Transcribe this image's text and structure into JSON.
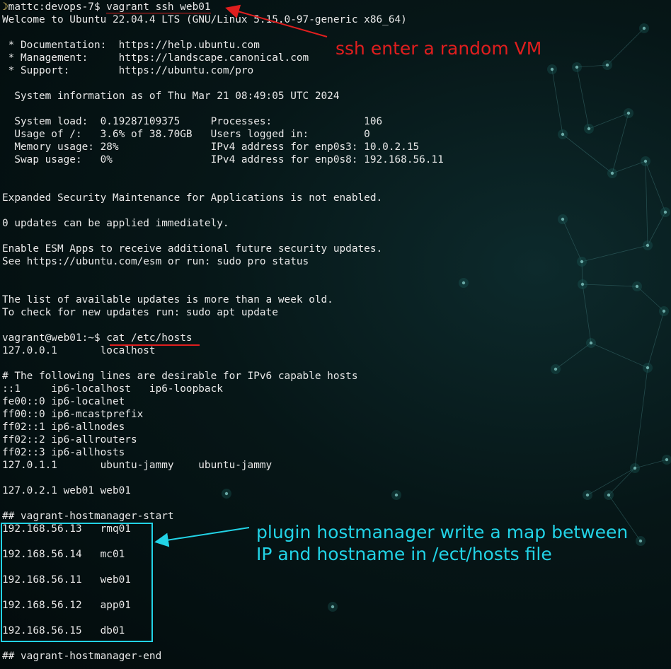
{
  "terminal": {
    "prompt_icon": "moon-icon",
    "lines": [
      "mattc:devops-7$ vagrant ssh web01",
      "Welcome to Ubuntu 22.04.4 LTS (GNU/Linux 5.15.0-97-generic x86_64)",
      "",
      " * Documentation:  https://help.ubuntu.com",
      " * Management:     https://landscape.canonical.com",
      " * Support:        https://ubuntu.com/pro",
      "",
      "  System information as of Thu Mar 21 08:49:05 UTC 2024",
      "",
      "  System load:  0.19287109375     Processes:               106",
      "  Usage of /:   3.6% of 38.70GB   Users logged in:         0",
      "  Memory usage: 28%               IPv4 address for enp0s3: 10.0.2.15",
      "  Swap usage:   0%                IPv4 address for enp0s8: 192.168.56.11",
      "",
      "",
      "Expanded Security Maintenance for Applications is not enabled.",
      "",
      "0 updates can be applied immediately.",
      "",
      "Enable ESM Apps to receive additional future security updates.",
      "See https://ubuntu.com/esm or run: sudo pro status",
      "",
      "",
      "The list of available updates is more than a week old.",
      "To check for new updates run: sudo apt update",
      "",
      "vagrant@web01:~$ cat /etc/hosts",
      "127.0.0.1       localhost",
      "",
      "# The following lines are desirable for IPv6 capable hosts",
      "::1     ip6-localhost   ip6-loopback",
      "fe00::0 ip6-localnet",
      "ff00::0 ip6-mcastprefix",
      "ff02::1 ip6-allnodes",
      "ff02::2 ip6-allrouters",
      "ff02::3 ip6-allhosts",
      "127.0.1.1       ubuntu-jammy    ubuntu-jammy",
      "",
      "127.0.2.1 web01 web01",
      "",
      "## vagrant-hostmanager-start",
      "192.168.56.13   rmq01",
      "",
      "192.168.56.14   mc01",
      "",
      "192.168.56.11   web01",
      "",
      "192.168.56.12   app01",
      "",
      "192.168.56.15   db01",
      "",
      "## vagrant-hostmanager-end"
    ]
  },
  "annotations": {
    "ssh_note": "ssh enter a random VM",
    "hostmanager_note_line1": "plugin hostmanager write a map between",
    "hostmanager_note_line2": "IP and hostname in /ect/hosts file",
    "red_color": "#e01e1e",
    "cyan_color": "#22d3e6"
  }
}
